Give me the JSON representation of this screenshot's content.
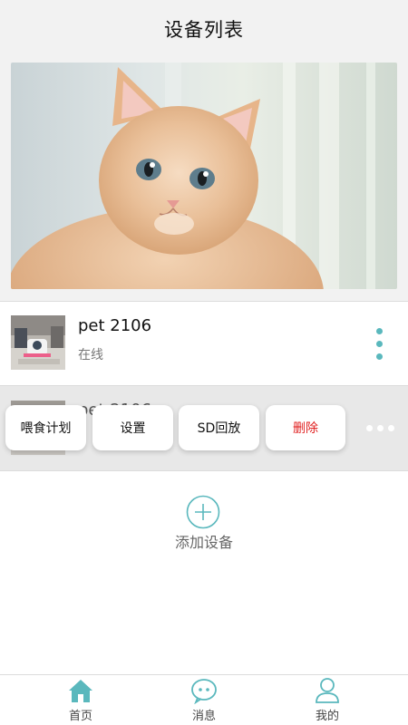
{
  "header": {
    "title": "设备列表"
  },
  "devices": [
    {
      "name": "pet 2106",
      "status": "在线"
    },
    {
      "name": "pet 2106"
    }
  ],
  "actions": {
    "feeding_plan": "喂食计划",
    "settings": "设置",
    "sd_playback": "SD回放",
    "delete": "删除"
  },
  "add_device": {
    "label": "添加设备"
  },
  "tabbar": {
    "items": [
      {
        "label": "首页",
        "icon": "home-icon"
      },
      {
        "label": "消息",
        "icon": "message-icon"
      },
      {
        "label": "我的",
        "icon": "profile-icon"
      }
    ]
  },
  "colors": {
    "accent": "#5ab8bd",
    "danger": "#e02020"
  }
}
